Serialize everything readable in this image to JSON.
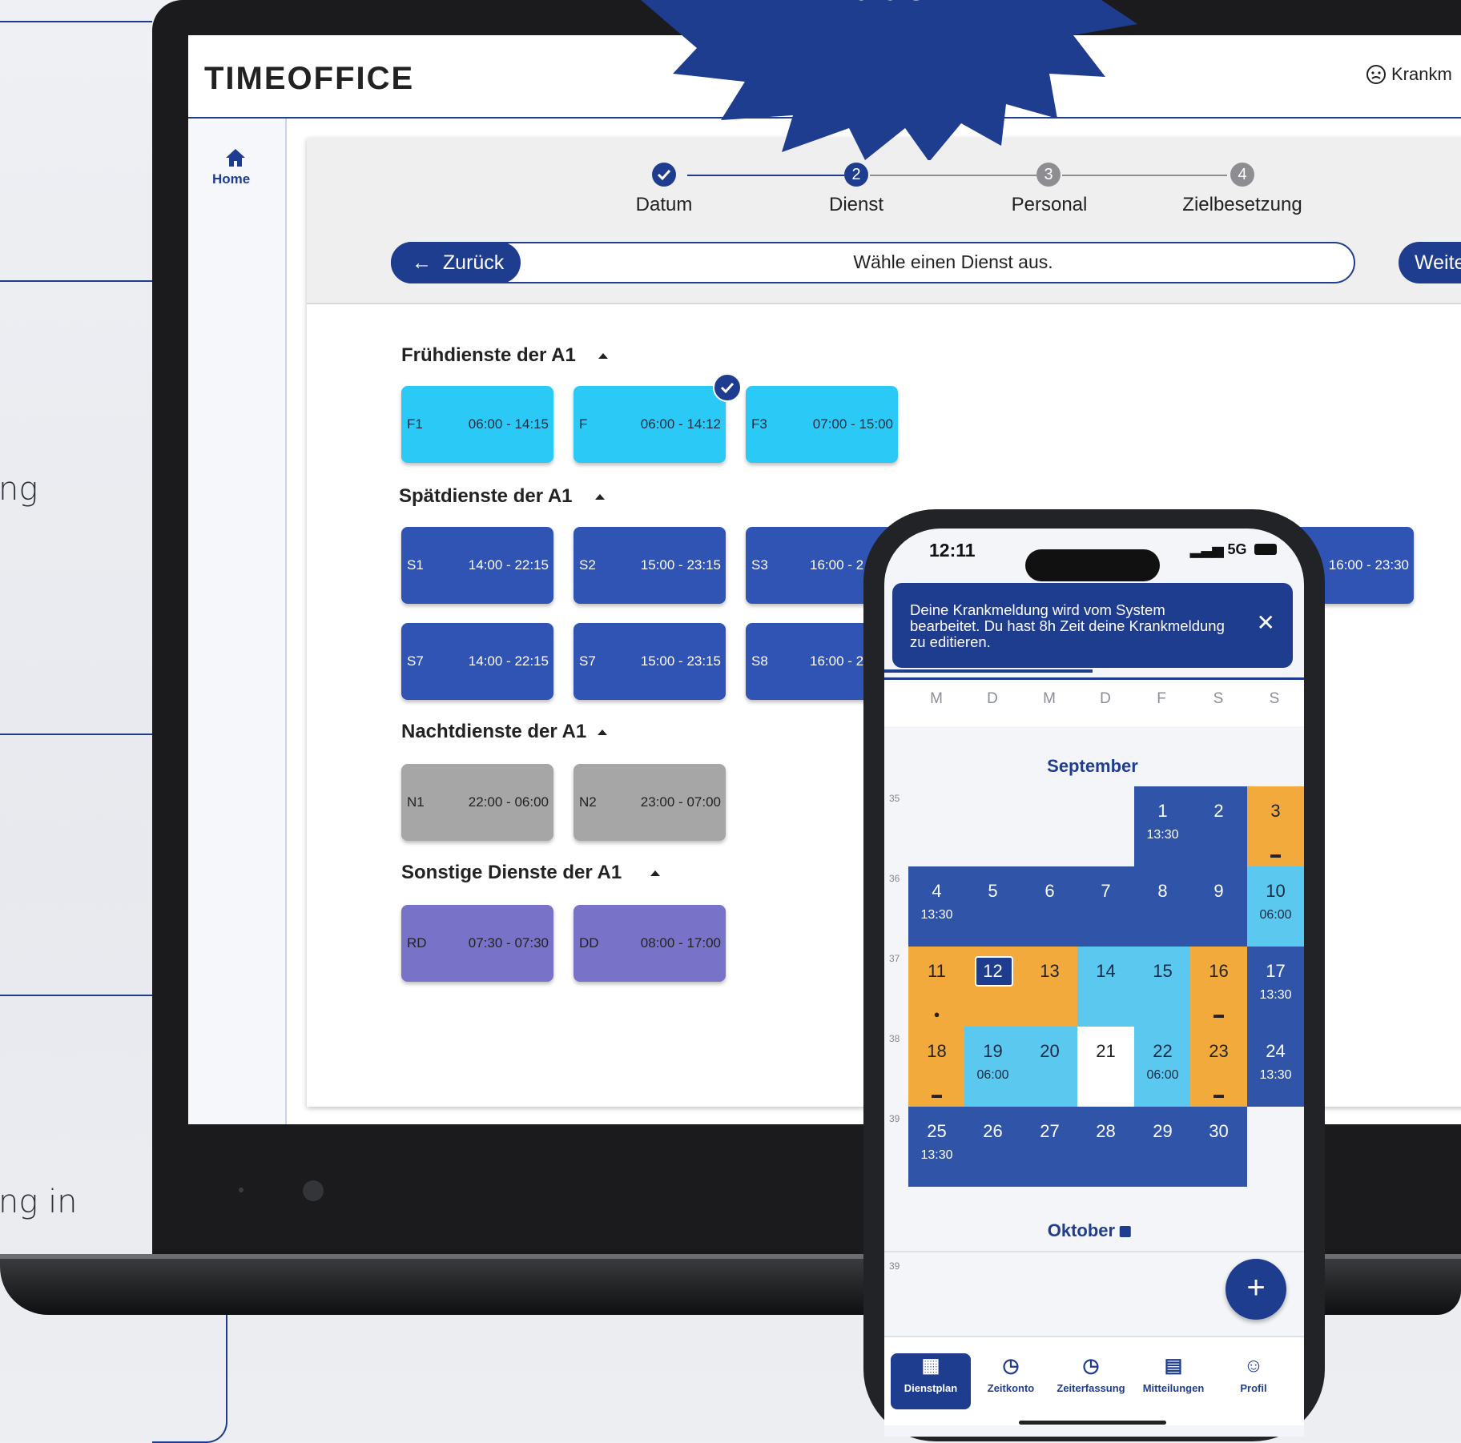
{
  "colors": {
    "brand": "#1f3d8f",
    "cyan": "#2bcaf6",
    "orange": "#f2aa3c",
    "grey": "#a6a6a6",
    "purple": "#7873c8"
  },
  "left_fragments": [
    "ng",
    "ng in"
  ],
  "badge": {
    "text": "ators"
  },
  "app": {
    "logo": "TIMEOFFICE",
    "header_right": "Krankm",
    "header_right_icon": "sick-face-icon",
    "sidebar": {
      "home_label": "Home",
      "home_icon": "home-icon"
    }
  },
  "wizard": {
    "steps": [
      {
        "label": "Datum",
        "num": "",
        "state": "done"
      },
      {
        "label": "Dienst",
        "num": "2",
        "state": "active"
      },
      {
        "label": "Personal",
        "num": "3",
        "state": "pending"
      },
      {
        "label": "Zielbesetzung",
        "num": "4",
        "state": "pending"
      }
    ],
    "back_label": "Zurück",
    "instruction": "Wähle einen Dienst aus.",
    "next_label": "Weite"
  },
  "groups": [
    {
      "title": "Frühdienste der A1"
    },
    {
      "title": "Spätdienste der A1"
    },
    {
      "title": "Nachtdienste der A1"
    },
    {
      "title": "Sonstige Dienste der A1"
    }
  ],
  "tiles": {
    "frueh": [
      {
        "code": "F1",
        "time": "06:00 - 14:15"
      },
      {
        "code": "F",
        "time": "06:00 - 14:12",
        "selected": true
      },
      {
        "code": "F3",
        "time": "07:00 - 15:00"
      }
    ],
    "spaet1": [
      {
        "code": "S1",
        "time": "14:00 - 22:15"
      },
      {
        "code": "S2",
        "time": "15:00 - 23:15"
      },
      {
        "code": "S3",
        "time": "16:00 - 2"
      },
      {
        "code": "",
        "time": "16:00 - 23:30"
      }
    ],
    "spaet2": [
      {
        "code": "S7",
        "time": "14:00 - 22:15"
      },
      {
        "code": "S7",
        "time": "15:00 - 23:15"
      },
      {
        "code": "S8",
        "time": "16:00 - 2"
      }
    ],
    "nacht": [
      {
        "code": "N1",
        "time": "22:00 - 06:00"
      },
      {
        "code": "N2",
        "time": "23:00 - 07:00"
      }
    ],
    "sonst": [
      {
        "code": "RD",
        "time": "07:30 - 07:30"
      },
      {
        "code": "DD",
        "time": "08:00 - 17:00"
      }
    ]
  },
  "phone": {
    "time": "12:11",
    "signal": "5G",
    "toast": "Deine Krankmeldung wird vom System bearbeitet. Du hast 8h Zeit deine Krankmeldung zu editieren.",
    "weekdays": [
      "M",
      "D",
      "M",
      "D",
      "F",
      "S",
      "S"
    ],
    "month1": "September",
    "month2": "Oktober",
    "week_numbers": [
      "35",
      "36",
      "37",
      "38",
      "39",
      "39"
    ],
    "days": [
      {
        "n": "1",
        "t": "13:30"
      },
      {
        "n": "2",
        "t": ""
      },
      {
        "n": "3",
        "t": ""
      },
      {
        "n": "4",
        "t": "13:30"
      },
      {
        "n": "5",
        "t": ""
      },
      {
        "n": "6",
        "t": ""
      },
      {
        "n": "7",
        "t": ""
      },
      {
        "n": "8",
        "t": ""
      },
      {
        "n": "9",
        "t": ""
      },
      {
        "n": "10",
        "t": "06:00"
      },
      {
        "n": "11",
        "t": ""
      },
      {
        "n": "12",
        "t": ""
      },
      {
        "n": "13",
        "t": ""
      },
      {
        "n": "14",
        "t": ""
      },
      {
        "n": "15",
        "t": ""
      },
      {
        "n": "16",
        "t": ""
      },
      {
        "n": "17",
        "t": "13:30"
      },
      {
        "n": "18",
        "t": ""
      },
      {
        "n": "19",
        "t": "06:00"
      },
      {
        "n": "20",
        "t": ""
      },
      {
        "n": "21",
        "t": ""
      },
      {
        "n": "22",
        "t": "06:00"
      },
      {
        "n": "23",
        "t": ""
      },
      {
        "n": "24",
        "t": "13:30"
      },
      {
        "n": "25",
        "t": "13:30"
      },
      {
        "n": "26",
        "t": ""
      },
      {
        "n": "27",
        "t": ""
      },
      {
        "n": "28",
        "t": ""
      },
      {
        "n": "29",
        "t": ""
      },
      {
        "n": "30",
        "t": ""
      }
    ],
    "fab": "+",
    "nav": [
      {
        "label": "Dienstplan",
        "icon": "calendar-icon"
      },
      {
        "label": "Zeitkonto",
        "icon": "clock-icon"
      },
      {
        "label": "Zeiterfassung",
        "icon": "clock-check-icon"
      },
      {
        "label": "Mitteilungen",
        "icon": "message-icon"
      },
      {
        "label": "Profil",
        "icon": "person-icon"
      }
    ]
  }
}
